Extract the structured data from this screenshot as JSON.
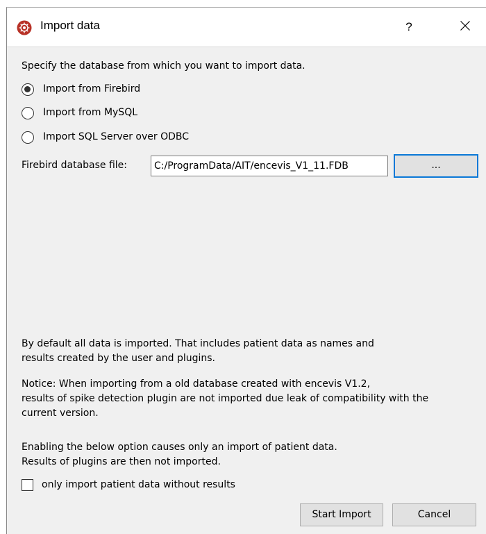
{
  "window": {
    "title": "Import data",
    "help_label": "?",
    "app_icon": "encevis-app-icon",
    "close_icon": "close-icon"
  },
  "form": {
    "prompt": "Specify the database from which you want to import data.",
    "sources": [
      {
        "label": "Import from Firebird",
        "selected": true
      },
      {
        "label": "Import from MySQL",
        "selected": false
      },
      {
        "label": "Import SQL Server over ODBC",
        "selected": false
      }
    ],
    "file_label": "Firebird database file:",
    "file_value": "C:/ProgramData/AIT/encevis_V1_11.FDB",
    "browse_label": "..."
  },
  "info": {
    "default_line1": "By default all data is imported. That includes patient data as names and",
    "default_line2": "results created by the user and plugins.",
    "notice_line1": "Notice: When importing from a old database created with encevis V1.2,",
    "notice_line2": "results of spike detection plugin are not imported due leak of compatibility with the",
    "notice_line3": "current version.",
    "option_line1": "Enabling the below option causes only an import of patient data.",
    "option_line2": "Results of plugins are then not imported."
  },
  "option": {
    "label": "only import patient data without results",
    "checked": false
  },
  "buttons": {
    "start": "Start Import",
    "cancel": "Cancel"
  },
  "colors": {
    "accent": "#0a78d7",
    "dialog_bg": "#f0f0f0",
    "icon_red": "#c0392b"
  }
}
